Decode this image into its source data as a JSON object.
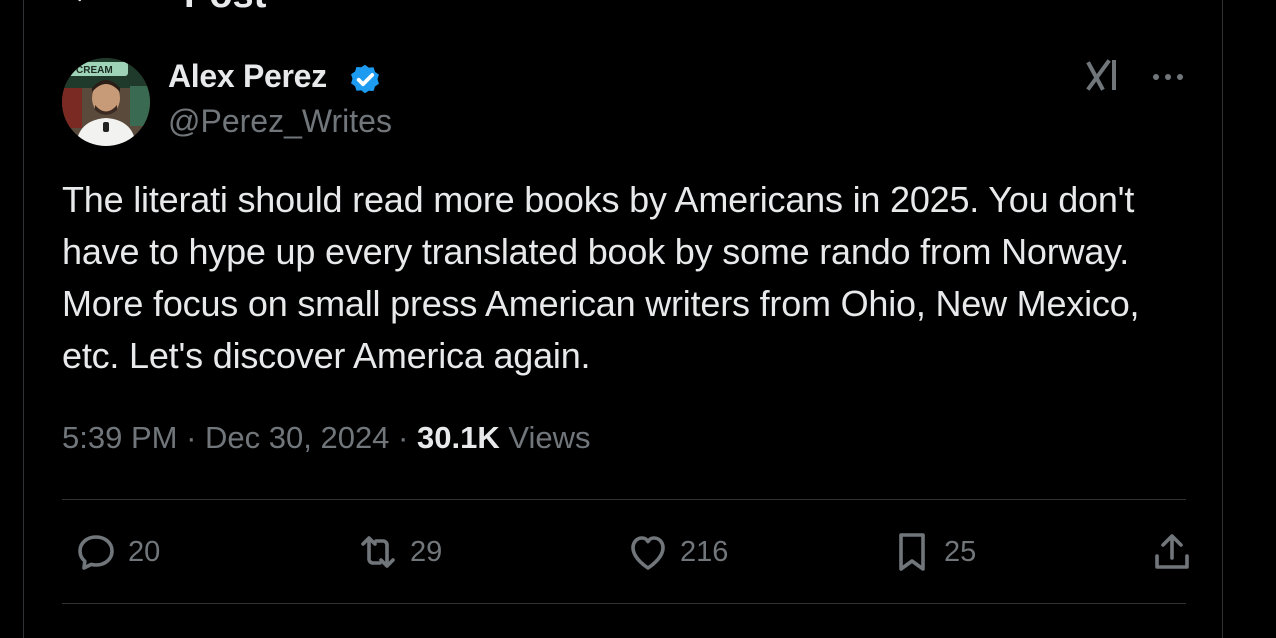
{
  "header": {
    "title": "Post"
  },
  "author": {
    "name": "Alex Perez",
    "handle": "@Perez_Writes",
    "verified": true,
    "avatar_sign_text": "CREAM"
  },
  "post": {
    "text": "The literati should read more books by Americans in 2025. You don't have to hype up every translated book by some rando from Norway. More focus on small press American writers from Ohio, New Mexico, etc. Let's discover America again.",
    "time": "5:39 PM",
    "separator": " · ",
    "date": "Dec 30, 2024",
    "views_count": "30.1K",
    "views_label": "Views"
  },
  "actions": {
    "replies": "20",
    "reposts": "29",
    "likes": "216",
    "bookmarks": "25"
  },
  "icons": {
    "back": "arrow-left-icon",
    "verified": "verified-badge-icon",
    "grok": "grok-icon",
    "more": "more-horizontal-icon",
    "reply": "reply-icon",
    "repost": "repost-icon",
    "like": "heart-icon",
    "bookmark": "bookmark-icon",
    "share": "share-icon"
  },
  "colors": {
    "background": "#000000",
    "text": "#e7e9ea",
    "muted": "#71767b",
    "verified": "#1d9bf0",
    "border": "#2f3336"
  }
}
